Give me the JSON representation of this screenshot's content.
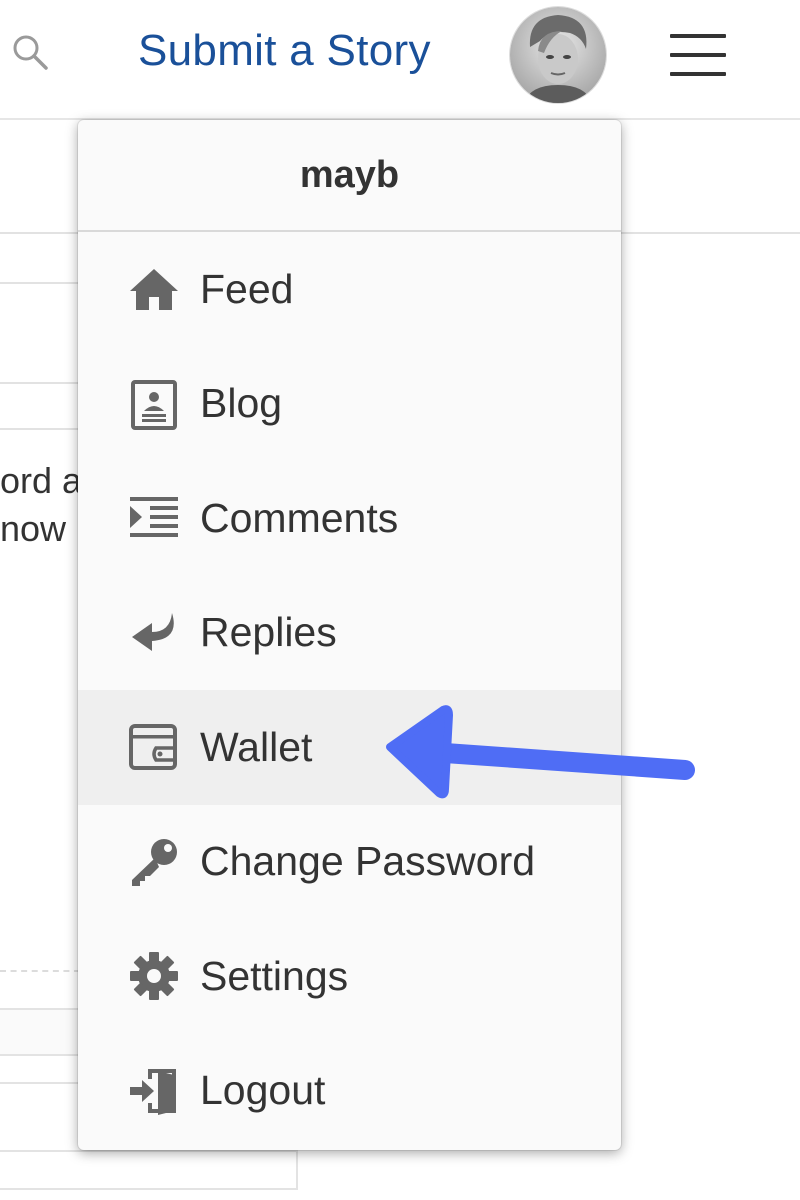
{
  "header": {
    "submit_label": "Submit a Story"
  },
  "background": {
    "snippet_line1": "ord a",
    "snippet_line2": "now"
  },
  "dropdown": {
    "username": "mayb",
    "items": [
      {
        "label": "Feed",
        "icon": "home-icon"
      },
      {
        "label": "Blog",
        "icon": "profile-card-icon"
      },
      {
        "label": "Comments",
        "icon": "indent-list-icon"
      },
      {
        "label": "Replies",
        "icon": "reply-arrow-icon"
      },
      {
        "label": "Wallet",
        "icon": "wallet-icon",
        "highlighted": true
      },
      {
        "label": "Change Password",
        "icon": "key-icon"
      },
      {
        "label": "Settings",
        "icon": "gear-icon"
      },
      {
        "label": "Logout",
        "icon": "logout-icon"
      }
    ]
  },
  "colors": {
    "link_blue": "#1a5099",
    "annotation_arrow": "#4f6df5",
    "highlight_row": "#efefef"
  }
}
